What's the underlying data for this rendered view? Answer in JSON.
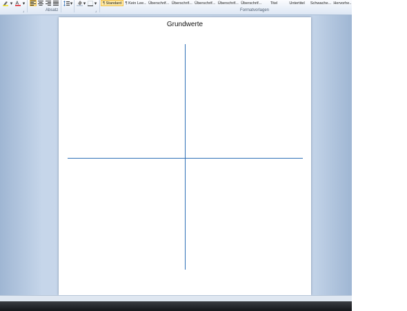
{
  "ribbon": {
    "group_paragraph_label": "Absatz",
    "group_styles_label": "Formatvorlagen",
    "styles": [
      {
        "label": "¶ Standard",
        "selected": true
      },
      {
        "label": "¶ Kein Lee...",
        "selected": false
      },
      {
        "label": "Überschrif...",
        "selected": false
      },
      {
        "label": "Überschrif...",
        "selected": false
      },
      {
        "label": "Überschrif...",
        "selected": false
      },
      {
        "label": "Überschrif...",
        "selected": false
      },
      {
        "label": "Überschrif...",
        "selected": false
      },
      {
        "label": "Titel",
        "selected": false
      },
      {
        "label": "Untertitel",
        "selected": false
      },
      {
        "label": "Schwache...",
        "selected": false
      },
      {
        "label": "Hervorhe...",
        "selected": false
      }
    ],
    "icons": {
      "highlight": "highlighter-icon",
      "font_color": "font-color-icon",
      "align_left": "align-left-icon",
      "align_center": "align-center-icon",
      "align_right": "align-right-icon",
      "justify": "justify-icon",
      "line_spacing": "line-spacing-icon",
      "shading": "shading-icon",
      "borders": "borders-icon"
    }
  },
  "document": {
    "title": "Grundwerte",
    "axis_color": "#2e6fb7"
  },
  "colors": {
    "selected_style_bg": "#fde9a6",
    "selected_style_border": "#f3c24b",
    "font_color_swatch": "#e0262d"
  }
}
